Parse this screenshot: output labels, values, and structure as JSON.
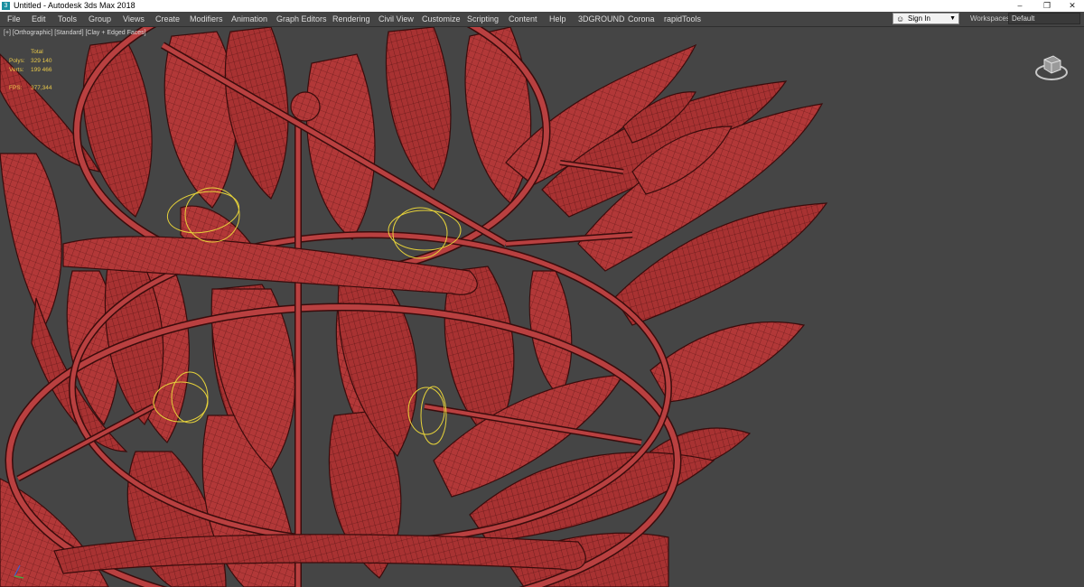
{
  "window": {
    "title": "Untitled - Autodesk 3ds Max 2018",
    "app_icon": "3",
    "controls": [
      "–",
      "❐",
      "✕"
    ]
  },
  "menubar": {
    "items": [
      "File",
      "Edit",
      "Tools",
      "Group",
      "Views",
      "Create",
      "Modifiers",
      "Animation",
      "Graph Editors",
      "Rendering",
      "Civil View",
      "Customize",
      "Scripting",
      "Content",
      "Help",
      "3DGROUND",
      "Corona",
      "rapidTools"
    ],
    "signin_label": "Sign In",
    "workspaces_label": "Workspaces:",
    "workspace_value": "Default"
  },
  "viewport": {
    "label": "[+] [Orthographic] [Standard] [Clay + Edged Faces]",
    "stats": {
      "header": "Total",
      "polys_label": "Polys:",
      "polys_value": "329 140",
      "verts_label": "Verts:",
      "verts_value": "199 466",
      "fps_label": "FPS:",
      "fps_value": "377,344"
    },
    "model_color": "#b53a3a",
    "background_color": "#454545",
    "selection_color": "#e6d23a"
  }
}
